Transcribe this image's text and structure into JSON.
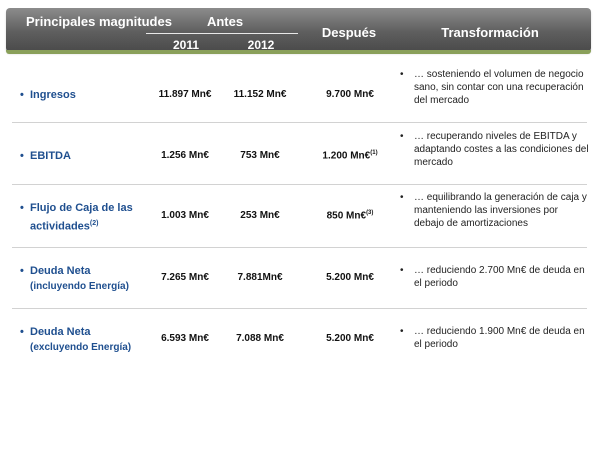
{
  "header": {
    "principales": "Principales magnitudes",
    "antes": "Antes",
    "year_2011": "2011",
    "year_2012": "2012",
    "despues": "Después",
    "transformacion": "Transformación"
  },
  "rows": [
    {
      "bullet": "•",
      "label": "Ingresos",
      "label_sub": "",
      "label_sup": "",
      "v2011": "11.897 Mn€",
      "v2012": "11.152 Mn€",
      "despues": "9.700 Mn€",
      "despues_sup": "",
      "note_bullet": "•",
      "note": "… sosteniendo el volumen de negocio sano, sin contar con una recuperación del mercado"
    },
    {
      "bullet": "•",
      "label": "EBITDA",
      "label_sub": "",
      "label_sup": "",
      "v2011": "1.256 Mn€",
      "v2012": "753 Mn€",
      "despues": "1.200 Mn€",
      "despues_sup": "(1)",
      "note_bullet": "•",
      "note": "… recuperando niveles de EBITDA y adaptando costes a las condiciones del mercado"
    },
    {
      "bullet": "•",
      "label": "Flujo de Caja de las actividades",
      "label_sub": "",
      "label_sup": "(2)",
      "v2011": "1.003 Mn€",
      "v2012": "253 Mn€",
      "despues": "850 Mn€",
      "despues_sup": "(3)",
      "note_bullet": "•",
      "note": "… equilibrando la generación de caja y manteniendo las inversiones por debajo de amortizaciones"
    },
    {
      "bullet": "•",
      "label": "Deuda Neta",
      "label_sub": "(incluyendo Energía)",
      "label_sup": "",
      "v2011": "7.265 Mn€",
      "v2012": "7.881Mn€",
      "despues": "5.200 Mn€",
      "despues_sup": "",
      "note_bullet": "•",
      "note": "… reduciendo 2.700 Mn€ de deuda en el periodo"
    },
    {
      "bullet": "•",
      "label": "Deuda Neta",
      "label_sub": "(excluyendo Energía)",
      "label_sup": "",
      "v2011": "6.593 Mn€",
      "v2012": "7.088 Mn€",
      "despues": "5.200 Mn€",
      "despues_sup": "",
      "note_bullet": "•",
      "note": "… reduciendo 1.900 Mn€ de deuda en el periodo"
    }
  ],
  "colors": {
    "label_blue": "#1f4f8f",
    "header_gray": "#5e5e5e",
    "header_accent_green": "#8aa05a"
  }
}
